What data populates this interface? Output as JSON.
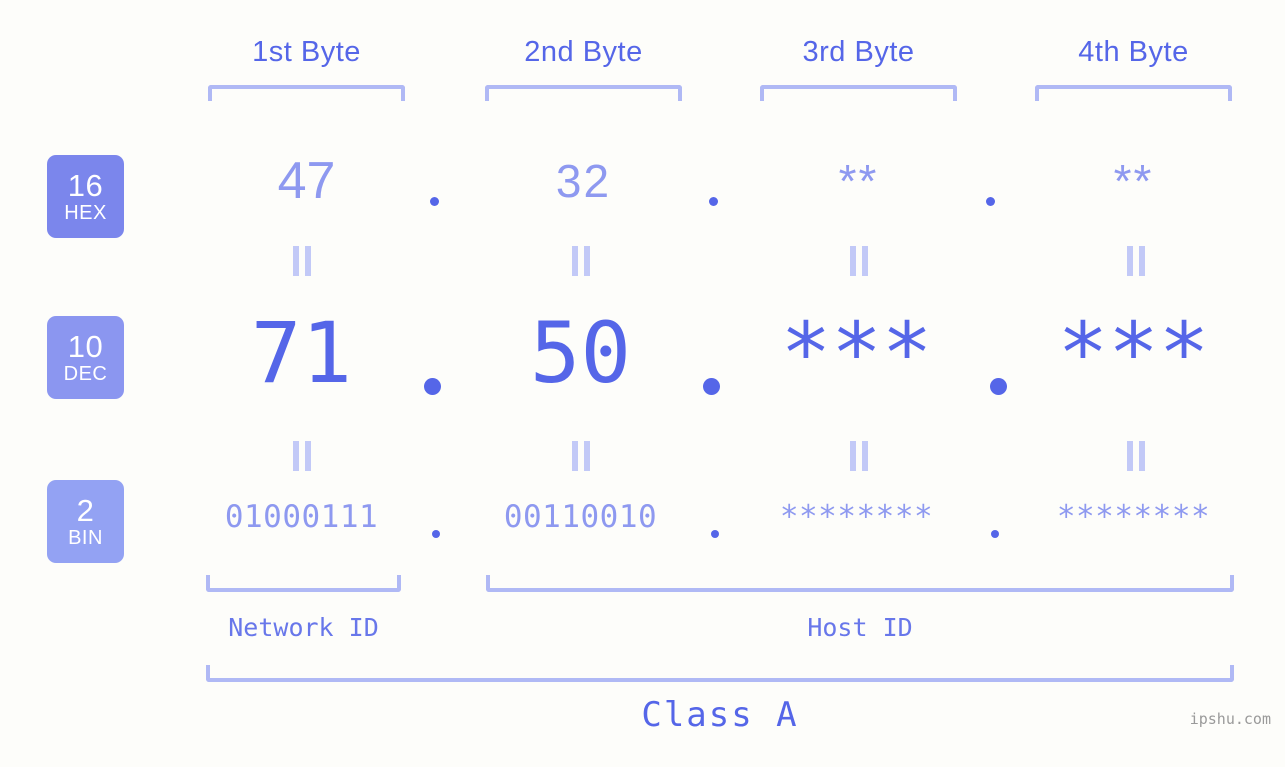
{
  "background_color": "#fdfdfa",
  "accent_color": "#5566e8",
  "accent_light_color": "#8e99f0",
  "bracket_color": "#b0b9f5",
  "byte_headers": [
    {
      "label": "1st Byte"
    },
    {
      "label": "2nd Byte"
    },
    {
      "label": "3rd Byte"
    },
    {
      "label": "4th Byte"
    }
  ],
  "rows": [
    {
      "badge_number": "16",
      "badge_name": "HEX",
      "badge_color": "#7b86ec",
      "values": [
        "47",
        "32",
        "**",
        "**"
      ],
      "separators": [
        ".",
        ".",
        "."
      ]
    },
    {
      "badge_number": "10",
      "badge_name": "DEC",
      "badge_color": "#8b96f0",
      "values": [
        "71",
        "50",
        "***",
        "***"
      ],
      "separators": [
        ".",
        ".",
        "."
      ]
    },
    {
      "badge_number": "2",
      "badge_name": "BIN",
      "badge_color": "#93a2f3",
      "values": [
        "01000111",
        "00110010",
        "********",
        "********"
      ],
      "separators": [
        ".",
        ".",
        "."
      ]
    }
  ],
  "equals_marks": "||",
  "id_sections": [
    {
      "label": "Network ID"
    },
    {
      "label": "Host ID"
    }
  ],
  "class_label": "Class A",
  "watermark": "ipshu.com"
}
